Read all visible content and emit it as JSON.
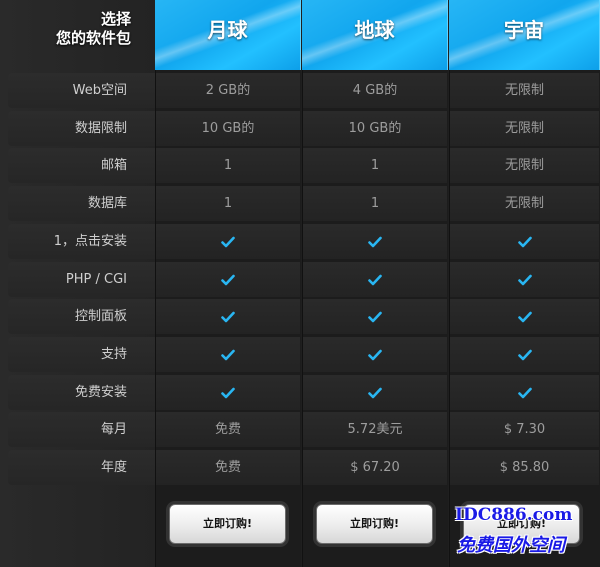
{
  "corner": {
    "line1": "选择",
    "line2": "您的软件包"
  },
  "plans": [
    {
      "name": "月球",
      "order_label": "立即订购!"
    },
    {
      "name": "地球",
      "order_label": "立即订购!"
    },
    {
      "name": "宇宙",
      "order_label": "立即订购!"
    }
  ],
  "rows": [
    {
      "label": "Web空间",
      "values": [
        "2 GB的",
        "4 GB的",
        "无限制"
      ]
    },
    {
      "label": "数据限制",
      "values": [
        "10 GB的",
        "10 GB的",
        "无限制"
      ]
    },
    {
      "label": "邮箱",
      "values": [
        "1",
        "1",
        "无限制"
      ]
    },
    {
      "label": "数据库",
      "values": [
        "1",
        "1",
        "无限制"
      ]
    },
    {
      "label": "1，点击安装",
      "values": [
        "check",
        "check",
        "check"
      ]
    },
    {
      "label": "PHP / CGI",
      "values": [
        "check",
        "check",
        "check"
      ]
    },
    {
      "label": "控制面板",
      "values": [
        "check",
        "check",
        "check"
      ]
    },
    {
      "label": "支持",
      "values": [
        "check",
        "check",
        "check"
      ]
    },
    {
      "label": "免费安装",
      "values": [
        "check",
        "check",
        "check"
      ]
    },
    {
      "label": "每月",
      "values": [
        "免费",
        "5.72美元",
        "$ 7.30"
      ]
    },
    {
      "label": "年度",
      "values": [
        "免费",
        "$ 67.20",
        "$ 85.80"
      ]
    }
  ],
  "watermark": {
    "line1": "IDC886.com",
    "line2": "免费国外空间"
  },
  "colors": {
    "accent": "#11a6ee",
    "check": "#29b6f2",
    "watermark": "#1a1ae6"
  }
}
